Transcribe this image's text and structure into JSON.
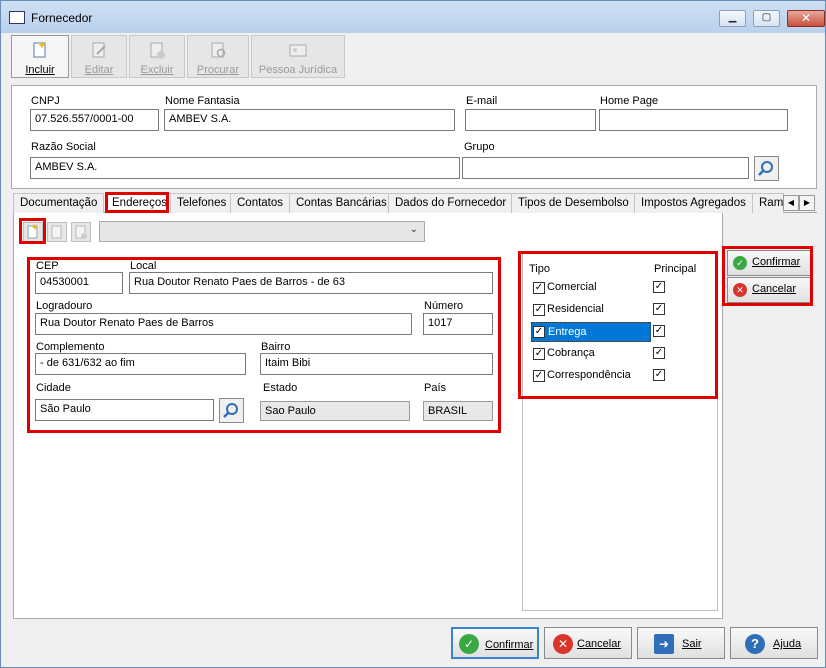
{
  "window": {
    "title": "Fornecedor"
  },
  "toolbar": {
    "incluir": "Incluir",
    "editar": "Editar",
    "excluir": "Excluir",
    "procurar": "Procurar",
    "pessoa_juridica": "Pessoa Jurídica"
  },
  "header": {
    "cnpj_label": "CNPJ",
    "cnpj_value": "07.526.557/0001-00",
    "nome_fantasia_label": "Nome Fantasia",
    "nome_fantasia_value": "AMBEV S.A.",
    "email_label": "E-mail",
    "email_value": "",
    "homepage_label": "Home Page",
    "homepage_value": "",
    "razao_social_label": "Razão Social",
    "razao_social_value": "AMBEV S.A.",
    "grupo_label": "Grupo",
    "grupo_value": ""
  },
  "tabs": [
    "Documentação",
    "Endereços",
    "Telefones",
    "Contatos",
    "Contas Bancárias",
    "Dados do Fornecedor",
    "Tipos de Desembolso",
    "Impostos Agregados",
    "Ram"
  ],
  "address": {
    "cep_label": "CEP",
    "cep_value": "04530001",
    "local_label": "Local",
    "local_value": "Rua Doutor Renato Paes de Barros - de 63",
    "logradouro_label": "Logradouro",
    "logradouro_value": "Rua Doutor Renato Paes de Barros",
    "numero_label": "Número",
    "numero_value": "1017",
    "complemento_label": "Complemento",
    "complemento_value": "- de 631/632 ao fim",
    "bairro_label": "Bairro",
    "bairro_value": "Itaim Bibi",
    "cidade_label": "Cidade",
    "cidade_value": "São Paulo",
    "estado_label": "Estado",
    "estado_value": "Sao Paulo",
    "pais_label": "País",
    "pais_value": "BRASIL"
  },
  "tipo": {
    "tipo_header": "Tipo",
    "principal_header": "Principal",
    "rows": [
      {
        "label": "Comercial",
        "checked": true,
        "principal": true
      },
      {
        "label": "Residencial",
        "checked": true,
        "principal": true
      },
      {
        "label": "Entrega",
        "checked": true,
        "principal": true,
        "selected": true
      },
      {
        "label": "Cobrança",
        "checked": true,
        "principal": true
      },
      {
        "label": "Correspondência",
        "checked": true,
        "principal": true
      }
    ]
  },
  "side_buttons": {
    "confirmar": "Confirmar",
    "cancelar": "Cancelar"
  },
  "bottom_buttons": {
    "confirmar": "Confirmar",
    "cancelar": "Cancelar",
    "sair": "Sair",
    "ajuda": "Ajuda"
  },
  "colors": {
    "highlight": "#e00000",
    "selection": "#0078d7",
    "confirm": "#3aa845",
    "cancel": "#d9352b"
  },
  "check_glyph": "✓"
}
